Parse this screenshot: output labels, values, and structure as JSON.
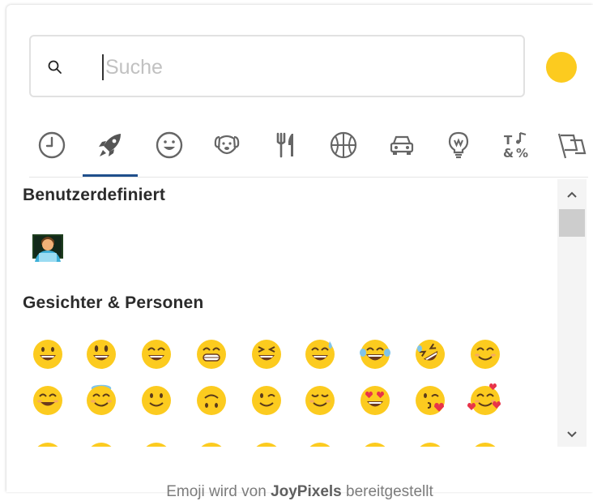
{
  "search": {
    "placeholder": "Suche",
    "value": ""
  },
  "skin_tone": {
    "color": "#FCCB1F"
  },
  "categories": [
    {
      "name": "recent",
      "icon": "clock-icon",
      "active": false
    },
    {
      "name": "custom",
      "icon": "rocket-icon",
      "active": true
    },
    {
      "name": "people",
      "icon": "smiley-icon",
      "active": false
    },
    {
      "name": "nature",
      "icon": "dog-icon",
      "active": false
    },
    {
      "name": "food",
      "icon": "fork-knife-icon",
      "active": false
    },
    {
      "name": "activity",
      "icon": "basketball-icon",
      "active": false
    },
    {
      "name": "travel",
      "icon": "car-icon",
      "active": false
    },
    {
      "name": "objects",
      "icon": "lightbulb-icon",
      "active": false
    },
    {
      "name": "symbols",
      "icon": "symbols-icon",
      "active": false
    },
    {
      "name": "flags",
      "icon": "flags-icon",
      "active": false
    }
  ],
  "accent_color": "#1F4F8C",
  "sections": {
    "custom": {
      "title": "Benutzerdefiniert",
      "emojis": [
        "technologist-emoji"
      ]
    },
    "people": {
      "title": "Gesichter & Personen",
      "emojis_row1": [
        "grinning-face",
        "grinning-face-big-eyes",
        "grinning-face-smiling-eyes",
        "beaming-face",
        "grinning-squinting-face",
        "grinning-face-sweat",
        "face-with-tears-of-joy",
        "rolling-on-floor-laughing",
        "smiling-face"
      ],
      "emojis_row2": [
        "smiling-face-smiling-eyes",
        "smiling-face-halo",
        "slightly-smiling-face",
        "upside-down-face",
        "winking-face",
        "relieved-face",
        "smiling-face-heart-eyes",
        "face-blowing-kiss",
        "smiling-face-hearts"
      ]
    }
  },
  "footer": {
    "prefix": "Emoji wird von ",
    "brand": "JoyPixels",
    "suffix": " bereitgestellt"
  },
  "colors": {
    "emoji_yellow": "#FCCB1F",
    "heart_red": "#E8334A",
    "halo_blue": "#7FC4EA"
  }
}
